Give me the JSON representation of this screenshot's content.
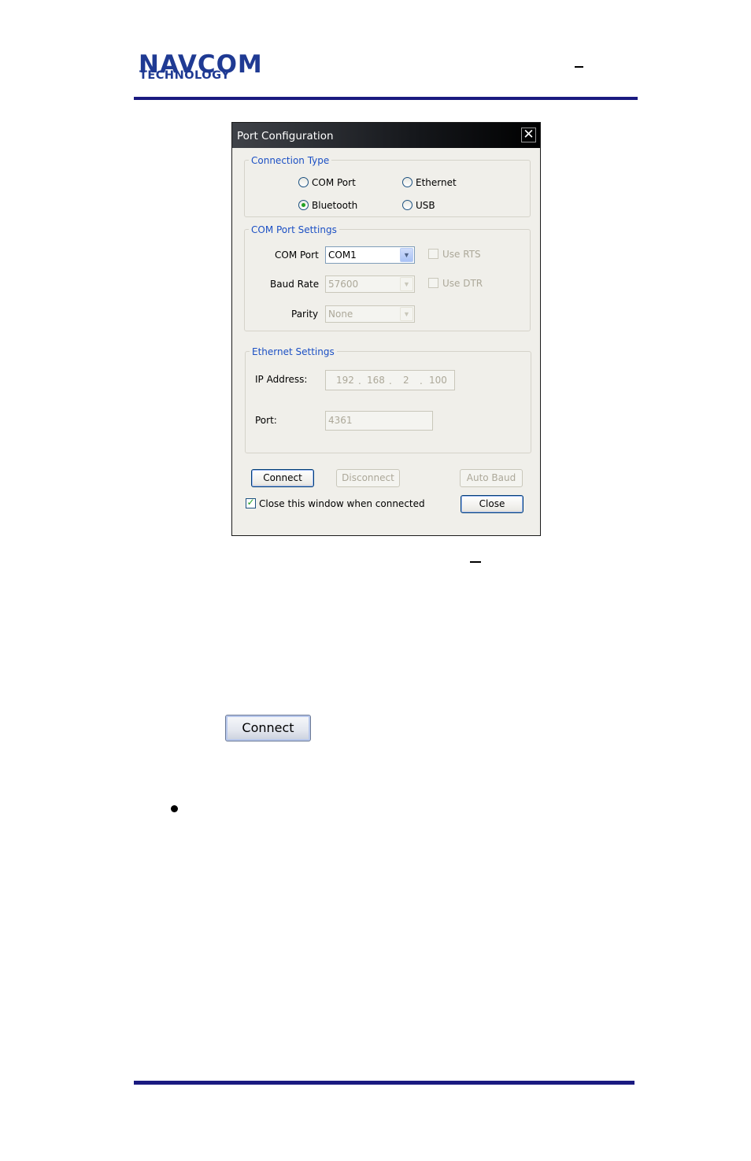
{
  "header": {
    "logo_line1": "NAVCOM",
    "logo_line2": "TECHNOLOGY",
    "brand_color": "#1f3a93"
  },
  "dialog": {
    "title": "Port Configuration",
    "close_icon": "close-x-icon",
    "connection_type": {
      "label": "Connection Type",
      "options": [
        {
          "label": "COM Port",
          "selected": false
        },
        {
          "label": "Ethernet",
          "selected": false
        },
        {
          "label": "Bluetooth",
          "selected": true
        },
        {
          "label": "USB",
          "selected": false
        }
      ]
    },
    "com_port_settings": {
      "label": "COM Port Settings",
      "com_port_label": "COM Port",
      "com_port_value": "COM1",
      "baud_rate_label": "Baud Rate",
      "baud_rate_value": "57600",
      "parity_label": "Parity",
      "parity_value": "None",
      "use_rts_label": "Use RTS",
      "use_dtr_label": "Use DTR"
    },
    "ethernet_settings": {
      "label": "Ethernet Settings",
      "ip_label": "IP Address:",
      "ip_octets": [
        "192",
        "168",
        "2",
        "100"
      ],
      "ip_dot": ".",
      "port_label": "Port:",
      "port_value": "4361"
    },
    "buttons": {
      "connect": "Connect",
      "disconnect": "Disconnect",
      "auto_baud": "Auto Baud",
      "close": "Close"
    },
    "close_when_connected_label": "Close this window when connected",
    "close_when_connected_checked": true
  },
  "connect_button_large": "Connect",
  "colors": {
    "rule": "#1a1a80",
    "group_label": "#1c50c4",
    "dialog_bg": "#f0efea",
    "radio_dot": "#21a121"
  }
}
